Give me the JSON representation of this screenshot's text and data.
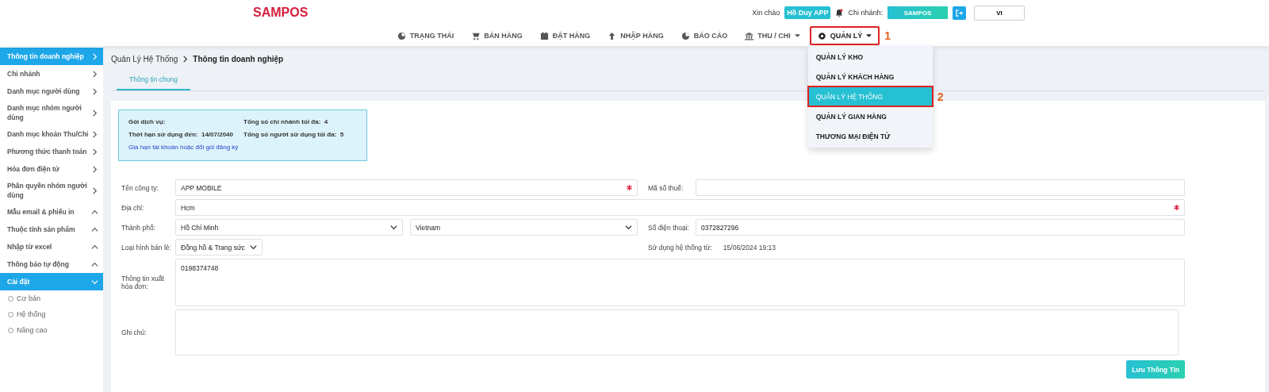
{
  "header": {
    "logo": "SAMPOS",
    "greeting": "Xin chào",
    "user": "Hồ Duy APP",
    "branch_label": "Chi nhánh:",
    "branch": "SAMPOS",
    "language": "VI"
  },
  "nav": {
    "items": [
      {
        "label": "TRẠNG THÁI",
        "kind": "link",
        "selected": false
      },
      {
        "label": "BÁN HÀNG",
        "kind": "link",
        "selected": false
      },
      {
        "label": "ĐẶT HÀNG",
        "kind": "link",
        "selected": false
      },
      {
        "label": "NHẬP HÀNG",
        "kind": "link",
        "selected": false
      },
      {
        "label": "BÁO CÁO",
        "kind": "link",
        "selected": false
      },
      {
        "label": "THU / CHI",
        "kind": "menu",
        "selected": false
      },
      {
        "label": "QUẢN LÝ",
        "kind": "menu",
        "selected": true,
        "annotation": "1"
      }
    ],
    "dropdown": [
      {
        "label": "QUẢN LÝ KHO",
        "selected": false
      },
      {
        "label": "QUẢN LÝ KHÁCH HÀNG",
        "selected": false
      },
      {
        "label": "QUẢN LÝ HỆ THỐNG",
        "selected": true,
        "annotation": "2"
      },
      {
        "label": "QUẢN LÝ GIAN HÀNG",
        "selected": false
      },
      {
        "label": "THƯƠNG MẠI ĐIỆN TỬ",
        "selected": false
      }
    ]
  },
  "sidebar": {
    "items": [
      {
        "label": "Thông tin doanh nghiệp",
        "kind": "page",
        "selected": true
      },
      {
        "label": "Chi nhánh",
        "kind": "page",
        "selected": false
      },
      {
        "label": "Danh mục người dùng",
        "kind": "page",
        "selected": false
      },
      {
        "label": "Danh mục nhóm người dùng",
        "kind": "page",
        "selected": false
      },
      {
        "label": "Danh mục khoản Thu/Chi",
        "kind": "page",
        "selected": false
      },
      {
        "label": "Phương thức thanh toán",
        "kind": "page",
        "selected": false
      },
      {
        "label": "Hóa đơn điện tử",
        "kind": "page",
        "selected": false
      },
      {
        "label": "Phân quyền nhóm người dùng",
        "kind": "page",
        "selected": false
      },
      {
        "label": "Mẫu email & phiếu in",
        "kind": "group",
        "selected": false,
        "expanded": false
      },
      {
        "label": "Thuộc tính sản phẩm",
        "kind": "group",
        "selected": false,
        "expanded": false
      },
      {
        "label": "Nhập từ excel",
        "kind": "group",
        "selected": false,
        "expanded": false
      },
      {
        "label": "Thông báo tự động",
        "kind": "group",
        "selected": false,
        "expanded": false
      },
      {
        "label": "Cài đặt",
        "kind": "group",
        "selected": true,
        "expanded": true,
        "children": [
          {
            "label": "Cơ bản"
          },
          {
            "label": "Hệ thống"
          },
          {
            "label": "Nâng cao"
          }
        ]
      }
    ]
  },
  "breadcrumb": [
    "Quản Lý Hệ Thống",
    "Thông tin doanh nghiệp"
  ],
  "tabs": [
    {
      "label": "Thông tin chung",
      "selected": true
    }
  ],
  "plan": {
    "service_label": "Gói dịch vụ:",
    "expiry_label": "Thời hạn sử dụng đến:",
    "expiry": "14/07/2040",
    "branches_label": "Tổng số chi nhánh tối đa:",
    "branches": "4",
    "users_label": "Tổng số người sử dụng tối đa:",
    "users": "5",
    "renew_link": "Gia hạn tài khoản hoặc đổi gói đăng ký"
  },
  "form": {
    "company": {
      "label": "Tên công ty:",
      "value": "APP MOBILE",
      "required": true
    },
    "tax_code": {
      "label": "Mã số thuế:",
      "required": false
    },
    "address": {
      "label": "Địa chỉ:",
      "value": "Hcm",
      "required": true
    },
    "city": {
      "label": "Thành phố:",
      "value": "Hồ Chí Minh"
    },
    "country": {
      "value": "Vietnam"
    },
    "phone": {
      "label": "Số điện thoại:",
      "value": "0372827296"
    },
    "retail_type": {
      "label": "Loại hình bán lẻ:",
      "value": "Đồng hồ & Trang sức"
    },
    "since": {
      "label": "Sử dụng hệ thống từ:",
      "value": "15/06/2024 19:13"
    },
    "invoice": {
      "label": "Thông tin xuất hóa đơn:",
      "value": "0198374748"
    },
    "note": {
      "label": "Ghi chú:"
    },
    "save": "Lưu Thông Tin"
  }
}
